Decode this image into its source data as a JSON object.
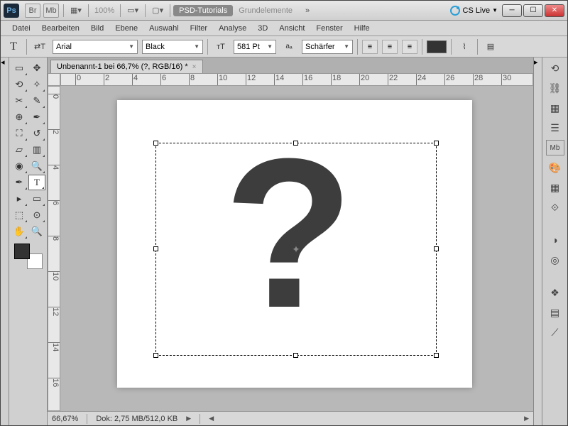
{
  "titlebar": {
    "app": "Ps",
    "zoom": "100%",
    "workspace_active": "PSD-Tutorials",
    "workspace_other": "Grundelemente",
    "cslive": "CS Live"
  },
  "menu": [
    "Datei",
    "Bearbeiten",
    "Bild",
    "Ebene",
    "Auswahl",
    "Filter",
    "Analyse",
    "3D",
    "Ansicht",
    "Fenster",
    "Hilfe"
  ],
  "options": {
    "font_family": "Arial",
    "font_style": "Black",
    "font_size": "581 Pt",
    "aa": "Schärfer"
  },
  "document": {
    "tab_title": "Unbenannt-1 bei 66,7% (?, RGB/16) *"
  },
  "ruler_h": [
    "0",
    "2",
    "4",
    "6",
    "8",
    "10",
    "12",
    "14",
    "16",
    "18",
    "20",
    "22",
    "24",
    "26",
    "28",
    "30"
  ],
  "ruler_v": [
    "0",
    "2",
    "4",
    "6",
    "8",
    "10",
    "12",
    "14",
    "16"
  ],
  "status": {
    "zoom": "66,67%",
    "doc_info": "Dok: 2,75 MB/512,0 KB"
  },
  "canvas": {
    "glyph": "?"
  }
}
